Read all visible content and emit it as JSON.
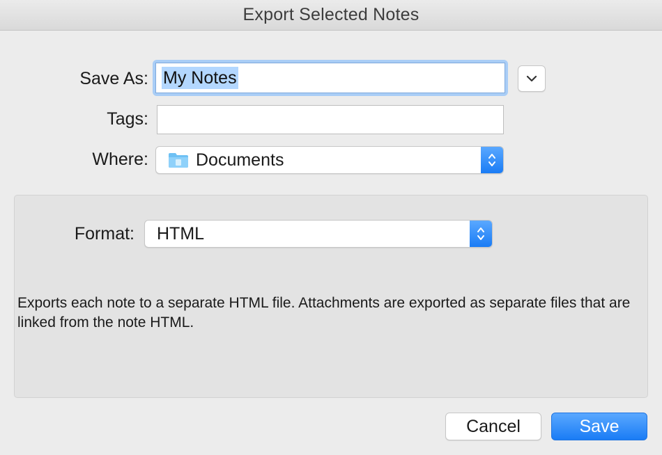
{
  "window": {
    "title": "Export Selected Notes"
  },
  "form": {
    "save_as_label": "Save As:",
    "save_as_value": "My Notes",
    "tags_label": "Tags:",
    "tags_value": "",
    "where_label": "Where:",
    "where_value": "Documents",
    "where_icon": "folder-icon"
  },
  "format": {
    "label": "Format:",
    "value": "HTML",
    "description": "Exports each note to a separate HTML file.  Attachments are exported as separate files that are linked from the note HTML."
  },
  "buttons": {
    "cancel_label": "Cancel",
    "save_label": "Save"
  },
  "colors": {
    "accent": "#1a7cf5",
    "selection": "#b3d7ff",
    "focus_ring": "#a9cdf6"
  }
}
